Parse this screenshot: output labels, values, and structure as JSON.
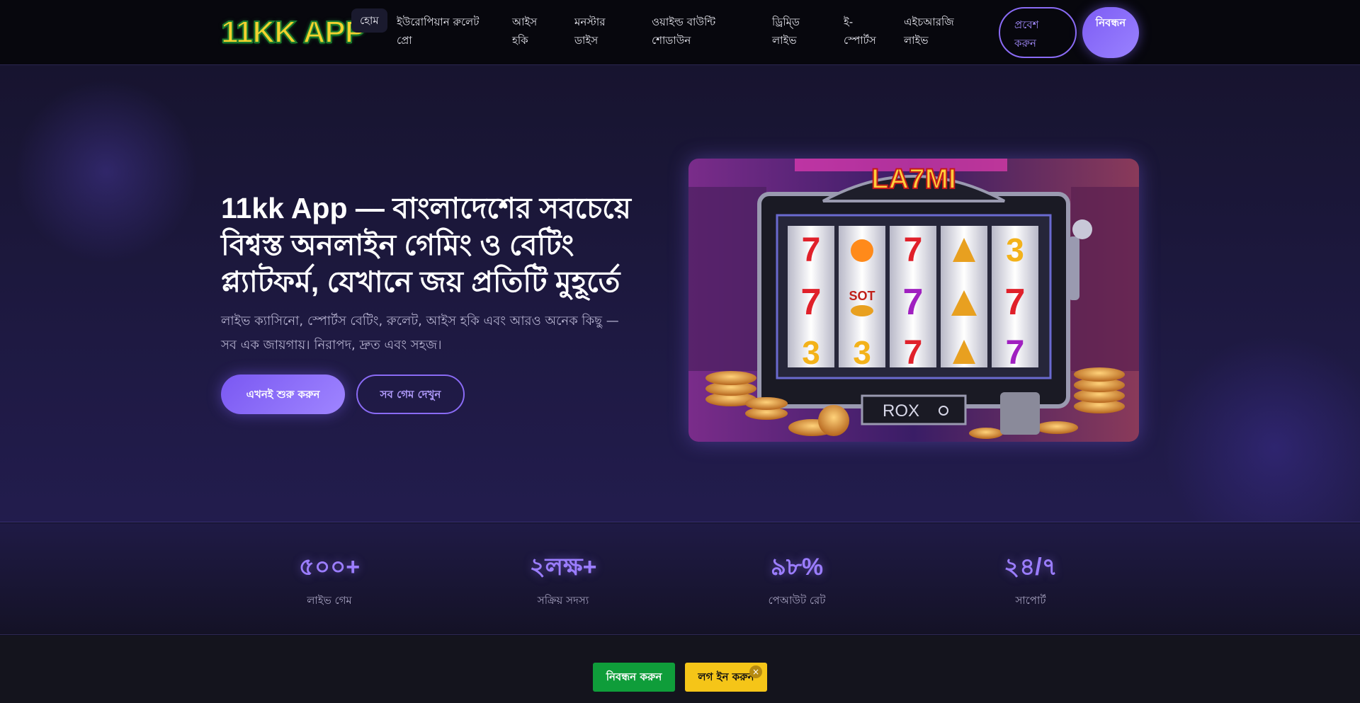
{
  "header": {
    "logo": "11KK APP",
    "nav": [
      {
        "label": "হোম"
      },
      {
        "line1": "ইউরোপিয়ান রুলেট",
        "line2": "প্রো"
      },
      {
        "line1": "আইস",
        "line2": "হকি"
      },
      {
        "line1": "মনস্টার",
        "line2": "ডাইস"
      },
      {
        "line1": "ওয়াইল্ড বাউন্টি",
        "line2": "শোডাউন"
      },
      {
        "line1": "ড্রিম্ডি",
        "line2": "লাইভ"
      },
      {
        "line1": "ই-",
        "line2": "স্পোর্টস"
      },
      {
        "line1": "এইচআরজি",
        "line2": "লাইভ"
      }
    ],
    "login": {
      "line1": "প্রবেশ",
      "line2": "করুন"
    },
    "register": "নিবন্ধন"
  },
  "hero": {
    "title": "11kk App — বাংলাদেশের সবচেয়ে বিশ্বস্ত অনলাইন গেমিং ও বেটিং প্ল্যাটফর্ম, যেখানে জয় প্রতিটি মুহূর্তে",
    "subtitle": "লাইভ ক্যাসিনো, স্পোর্টস বেটিং, রুলেট, আইস হকি এবং আরও অনেক কিছু — সব এক জায়গায়। নিরাপদ, দ্রুত এবং সহজ।",
    "primary_button": "এখনই শুরু করুন",
    "secondary_button": "সব গেম দেখুন",
    "image": {
      "top_sign": "LA7MI",
      "reel_label": "SOT",
      "plate": "ROX"
    }
  },
  "stats": [
    {
      "value": "৫০০+",
      "label": "লাইভ গেম"
    },
    {
      "value": "২লক্ষ+",
      "label": "সক্রিয় সদস্য"
    },
    {
      "value": "৯৮%",
      "label": "পেআউট রেট"
    },
    {
      "value": "২৪/৭",
      "label": "সাপোর্ট"
    }
  ],
  "bottom_bar": {
    "register": "নিবন্ধন করুন",
    "login": "লগ ইন করুন",
    "close": "×"
  },
  "colors": {
    "accent": "#8a6bf5",
    "green": "#0f9d3a",
    "yellow": "#f5c518"
  }
}
